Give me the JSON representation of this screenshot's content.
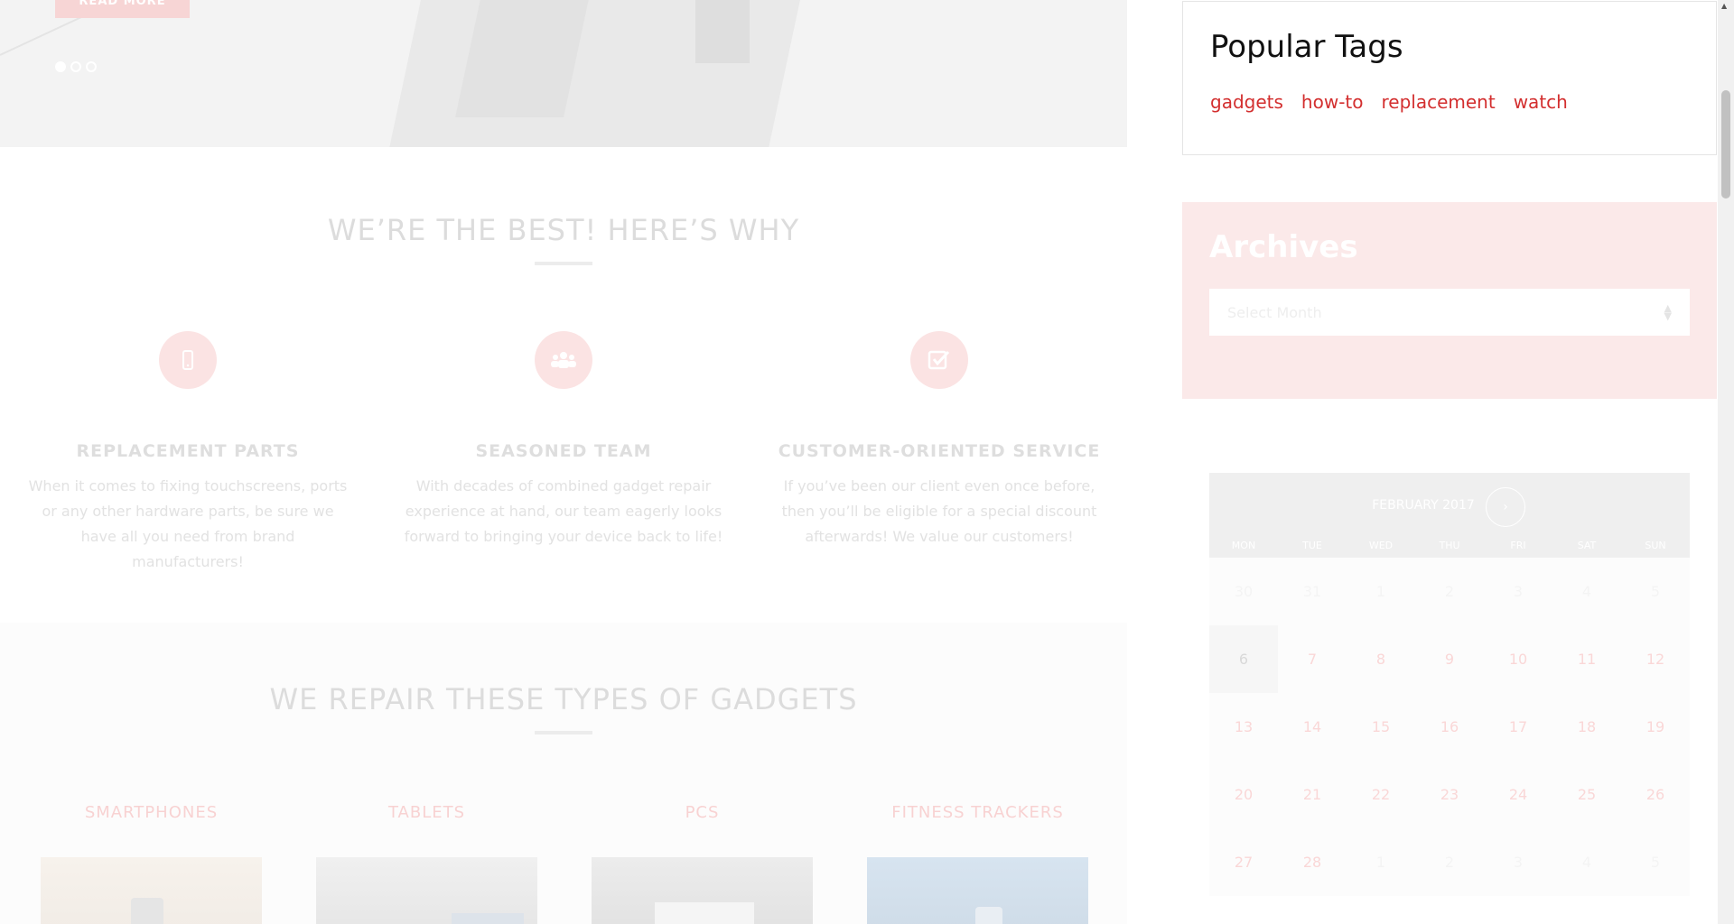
{
  "hero": {
    "button_label": "READ MORE",
    "slides": 3
  },
  "why": {
    "title": "WE’RE THE BEST! HERE’S WHY",
    "features": [
      {
        "icon": "smartphone-icon",
        "title": "REPLACEMENT PARTS",
        "text": "When it comes to fixing touchscreens, ports or any other hardware parts, be sure we have all you need from brand manufacturers!"
      },
      {
        "icon": "team-icon",
        "title": "SEASONED TEAM",
        "text": "With decades of combined gadget repair experience at hand, our team eagerly looks forward to bringing your device back to life!"
      },
      {
        "icon": "checkbox-icon",
        "title": "CUSTOMER-ORIENTED SERVICE",
        "text": "If you’ve been our client even once before, then you’ll be eligible for a special discount afterwards! We value our customers!"
      }
    ]
  },
  "gadgets": {
    "title": "WE REPAIR THESE TYPES OF GADGETS",
    "items": [
      {
        "label": "SMARTPHONES"
      },
      {
        "label": "TABLETS"
      },
      {
        "label": "PCS"
      },
      {
        "label": "FITNESS TRACKERS"
      }
    ]
  },
  "sidebar": {
    "tags_title": "Popular Tags",
    "tags": [
      "gadgets",
      "how-to",
      "replacement",
      "watch"
    ],
    "archives_title": "Archives",
    "archives_placeholder": "Select Month"
  },
  "calendar": {
    "month": "FEBRUARY 2017",
    "next_label": "›",
    "days_of_week": [
      "MON",
      "TUE",
      "WED",
      "THU",
      "FRI",
      "SAT",
      "SUN"
    ],
    "weeks": [
      [
        "30",
        "31",
        "1",
        "2",
        "3",
        "4",
        "5"
      ],
      [
        "6",
        "7",
        "8",
        "9",
        "10",
        "11",
        "12"
      ],
      [
        "13",
        "14",
        "15",
        "16",
        "17",
        "18",
        "19"
      ],
      [
        "20",
        "21",
        "22",
        "23",
        "24",
        "25",
        "26"
      ],
      [
        "27",
        "28",
        "1",
        "2",
        "3",
        "4",
        "5"
      ]
    ],
    "today": "6"
  },
  "colors": {
    "accent": "#d32f2f",
    "accent_faded": "#fbe3e3"
  }
}
